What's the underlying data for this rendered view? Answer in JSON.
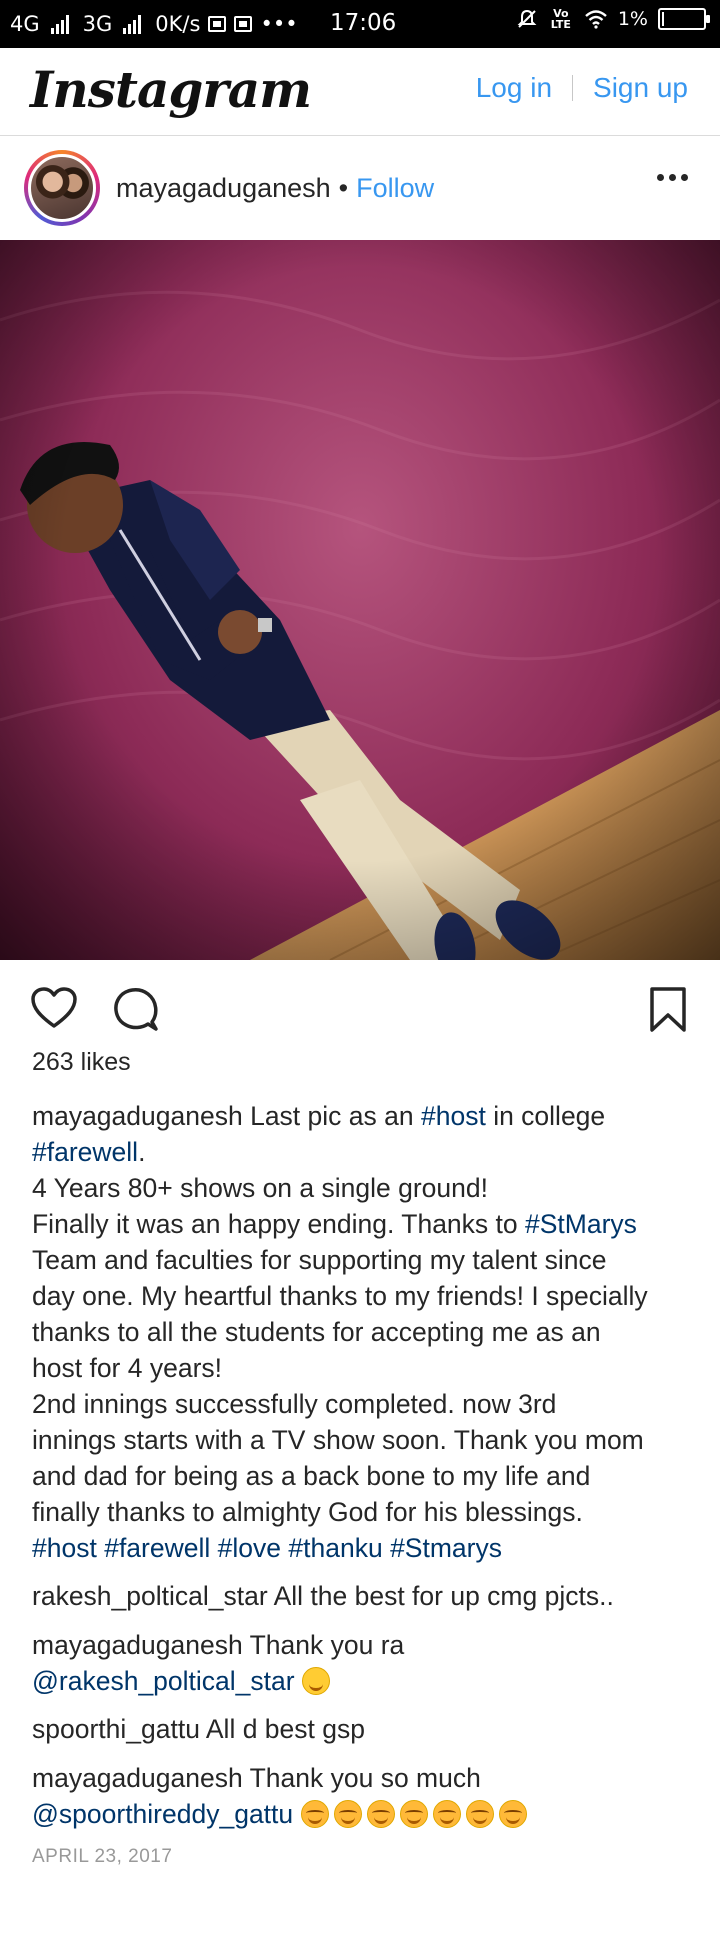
{
  "status_bar": {
    "network1": "4G",
    "network2": "3G",
    "speed": "0K/s",
    "time": "17:06",
    "volte": "Vo LTE",
    "battery": "1%"
  },
  "header": {
    "logo": "Instagram",
    "login_label": "Log in",
    "signup_label": "Sign up"
  },
  "post": {
    "username": "mayagaduganesh",
    "separator": "•",
    "follow_label": "Follow",
    "likes": "263 likes",
    "date": "APRIL 23, 2017",
    "caption": {
      "author": "mayagaduganesh",
      "l1_text": "Last pic as an",
      "l1_tag": "#host",
      "l1_after": "in college",
      "l2_tag": "#farewell",
      "l2_after": ".",
      "l3": "4 Years 80+ shows on a single ground!",
      "l4_text": "Finally it was an happy ending. Thanks to",
      "l4_tag": "#StMarys",
      "l5": "Team and faculties for supporting my talent since",
      "l6": "day one. My heartful thanks to my friends! I specially",
      "l7": "thanks to all the students for accepting me as an",
      "l8": "host for 4 years!",
      "l9": "2nd innings successfully completed. now 3rd",
      "l10": "innings starts with a TV show soon. Thank you mom",
      "l11": "and dad for being as a back bone to my life and",
      "l12": "finally thanks to almighty God for his blessings.",
      "hashtags": [
        "#host",
        "#farewell",
        "#love",
        "#thanku",
        "#Stmarys"
      ]
    },
    "comments": [
      {
        "user": "rakesh_poltical_star",
        "text": "All the best for up cmg pjcts.."
      },
      {
        "user": "mayagaduganesh",
        "text": "Thank you ra",
        "mention": "@rakesh_poltical_star",
        "emoji": "slightly-smiling-face"
      },
      {
        "user": "spoorthi_gattu",
        "text": "All d best gsp"
      },
      {
        "user": "mayagaduganesh",
        "text": "Thank you so much",
        "mention": "@spoorthireddy_gattu",
        "emoji": "smiling-face-with-smiling-eyes x7"
      }
    ]
  },
  "icons": {
    "like": "heart-icon",
    "comment": "comment-icon",
    "save": "bookmark-icon",
    "more": "more-options-icon"
  },
  "colors": {
    "link_blue": "#3897f0",
    "hashtag_blue": "#003569",
    "text": "#262626",
    "muted": "#999999"
  }
}
